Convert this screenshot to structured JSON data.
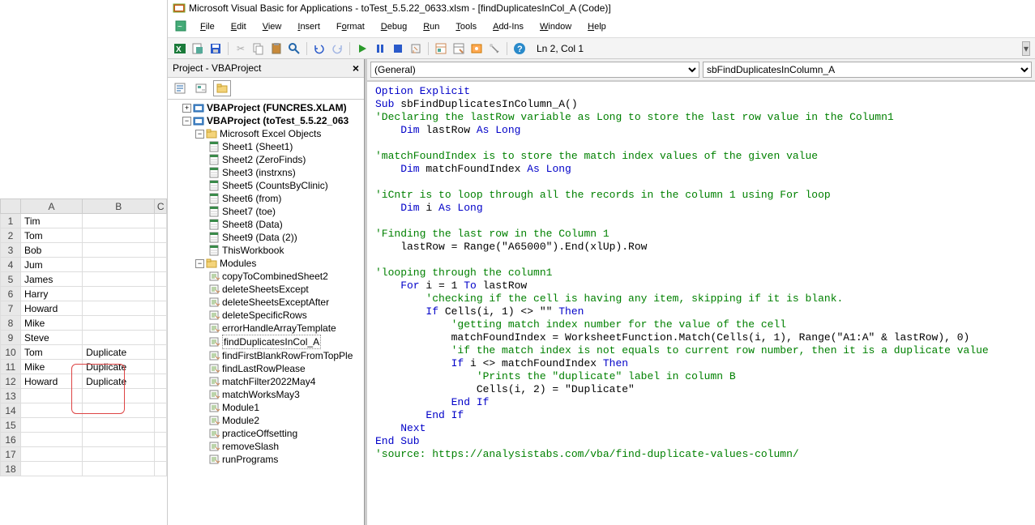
{
  "excel": {
    "cols": [
      "",
      "A",
      "B",
      "C"
    ],
    "rows": [
      {
        "n": "1",
        "a": "Tim",
        "b": ""
      },
      {
        "n": "2",
        "a": "Tom",
        "b": ""
      },
      {
        "n": "3",
        "a": "Bob",
        "b": ""
      },
      {
        "n": "4",
        "a": "Jum",
        "b": ""
      },
      {
        "n": "5",
        "a": "James",
        "b": ""
      },
      {
        "n": "6",
        "a": "Harry",
        "b": ""
      },
      {
        "n": "7",
        "a": "Howard",
        "b": ""
      },
      {
        "n": "8",
        "a": "Mike",
        "b": ""
      },
      {
        "n": "9",
        "a": "Steve",
        "b": ""
      },
      {
        "n": "10",
        "a": "Tom",
        "b": "Duplicate"
      },
      {
        "n": "11",
        "a": "Mike",
        "b": "Duplicate"
      },
      {
        "n": "12",
        "a": "Howard",
        "b": "Duplicate"
      },
      {
        "n": "13",
        "a": "",
        "b": ""
      },
      {
        "n": "14",
        "a": "",
        "b": ""
      },
      {
        "n": "15",
        "a": "",
        "b": ""
      },
      {
        "n": "16",
        "a": "",
        "b": ""
      },
      {
        "n": "17",
        "a": "",
        "b": ""
      },
      {
        "n": "18",
        "a": "",
        "b": ""
      }
    ]
  },
  "title": "Microsoft Visual Basic for Applications - toTest_5.5.22_0633.xlsm - [findDuplicatesInCol_A (Code)]",
  "menus": [
    "File",
    "Edit",
    "View",
    "Insert",
    "Format",
    "Debug",
    "Run",
    "Tools",
    "Add-Ins",
    "Window",
    "Help"
  ],
  "cursor_pos": "Ln 2, Col 1",
  "project_panel_title": "Project - VBAProject",
  "projects": {
    "p1": "VBAProject (FUNCRES.XLAM)",
    "p2": "VBAProject (toTest_5.5.22_063",
    "excel_objects_label": "Microsoft Excel Objects",
    "sheets": [
      "Sheet1 (Sheet1)",
      "Sheet2 (ZeroFinds)",
      "Sheet3 (instrxns)",
      "Sheet5 (CountsByClinic)",
      "Sheet6 (from)",
      "Sheet7 (toe)",
      "Sheet8 (Data)",
      "Sheet9 (Data (2))",
      "ThisWorkbook"
    ],
    "modules_label": "Modules",
    "modules": [
      "copyToCombinedSheet2",
      "deleteSheetsExcept",
      "deleteSheetsExceptAfter",
      "deleteSpecificRows",
      "errorHandleArrayTemplate",
      "findDuplicatesInCol_A",
      "findFirstBlankRowFromTopPle",
      "findLastRowPlease",
      "matchFilter2022May4",
      "matchWorksMay3",
      "Module1",
      "Module2",
      "practiceOffsetting",
      "removeSlash",
      "runPrograms"
    ],
    "selected_module": "findDuplicatesInCol_A"
  },
  "dropdown_left": "(General)",
  "dropdown_right": "sbFindDuplicatesInColumn_A",
  "code": {
    "l1": "Option Explicit",
    "l2a": "Sub",
    "l2b": " sbFindDuplicatesInColumn_A()",
    "l3": "'Declaring the lastRow variable as Long to store the last row value in the Column1",
    "l4a": "    Dim",
    "l4b": " lastRow ",
    "l4c": "As Long",
    "l5": "",
    "l6": "'matchFoundIndex is to store the match index values of the given value",
    "l7a": "    Dim",
    "l7b": " matchFoundIndex ",
    "l7c": "As Long",
    "l8": "",
    "l9": "'iCntr is to loop through all the records in the column 1 using For loop",
    "l10a": "    Dim",
    "l10b": " i ",
    "l10c": "As Long",
    "l11": "",
    "l12": "'Finding the last row in the Column 1",
    "l13": "    lastRow = Range(\"A65000\").End(xlUp).Row",
    "l14": "",
    "l15": "'looping through the column1",
    "l16a": "    For",
    "l16b": " i = 1 ",
    "l16c": "To",
    "l16d": " lastRow",
    "l17": "        'checking if the cell is having any item, skipping if it is blank.",
    "l18a": "        If",
    "l18b": " Cells(i, 1) <> \"\" ",
    "l18c": "Then",
    "l19": "            'getting match index number for the value of the cell",
    "l20": "            matchFoundIndex = WorksheetFunction.Match(Cells(i, 1), Range(\"A1:A\" & lastRow), 0)",
    "l21": "            'if the match index is not equals to current row number, then it is a duplicate value",
    "l22a": "            If",
    "l22b": " i <> matchFoundIndex ",
    "l22c": "Then",
    "l23": "                'Prints the \"duplicate\" label in column B",
    "l24": "                Cells(i, 2) = \"Duplicate\"",
    "l25": "            End If",
    "l26": "        End If",
    "l27": "    Next",
    "l28": "End Sub",
    "l29": "'source: https://analysistabs.com/vba/find-duplicate-values-column/"
  }
}
